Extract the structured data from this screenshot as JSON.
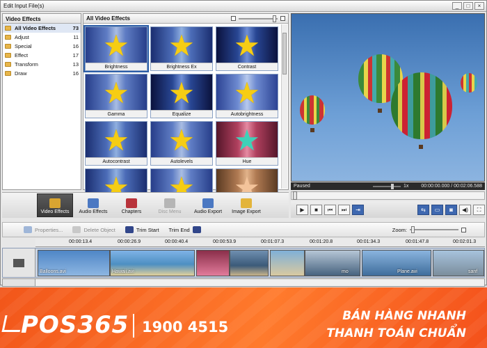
{
  "window": {
    "title": "Edit Input File(s)"
  },
  "categories_panel": {
    "title": "Video Effects",
    "items": [
      {
        "label": "All Video Effects",
        "count": "73"
      },
      {
        "label": "Adjust",
        "count": "11"
      },
      {
        "label": "Special",
        "count": "16"
      },
      {
        "label": "Effect",
        "count": "17"
      },
      {
        "label": "Transform",
        "count": "13"
      },
      {
        "label": "Draw",
        "count": "16"
      }
    ]
  },
  "effects_panel": {
    "title": "All Video Effects",
    "tiles": [
      "Brightness",
      "Brightness Ex",
      "Contrast",
      "Gamma",
      "Equalize",
      "Autobrightness",
      "Autocontrast",
      "Autolevels",
      "Hue",
      "",
      "",
      ""
    ]
  },
  "preview": {
    "state": "Paused",
    "speed": "1x",
    "time": "00:00:00.000 / 00:02:06.588"
  },
  "toolbar": {
    "video_effects": "Video Effects",
    "audio_effects": "Audio Effects",
    "chapters": "Chapters",
    "disc_menu": "Disc Menu",
    "audio_export": "Audio Export",
    "image_export": "Image Export"
  },
  "edit_tools": {
    "properties": "Properties...",
    "delete_object": "Delete Object",
    "trim_start": "Trim Start",
    "trim_end": "Trim End",
    "zoom_label": "Zoom:"
  },
  "timeline": {
    "ticks": [
      "00:00:13.4",
      "00:00:26.9",
      "00:00:40.4",
      "00:00:53.9",
      "00:01:07.3",
      "00:01:20.8",
      "00:01:34.3",
      "00:01:47.8",
      "00:02:01.3"
    ],
    "clips": [
      "Balloons.avi",
      "Hawaii.avi",
      "",
      "",
      "",
      "mo",
      "Plane.avi",
      "sanf"
    ]
  },
  "banner": {
    "logo": "POS365",
    "phone": "1900 4515",
    "slogan_line1": "BÁN HÀNG NHANH",
    "slogan_line2": "THANH TOÁN CHUẨN"
  }
}
